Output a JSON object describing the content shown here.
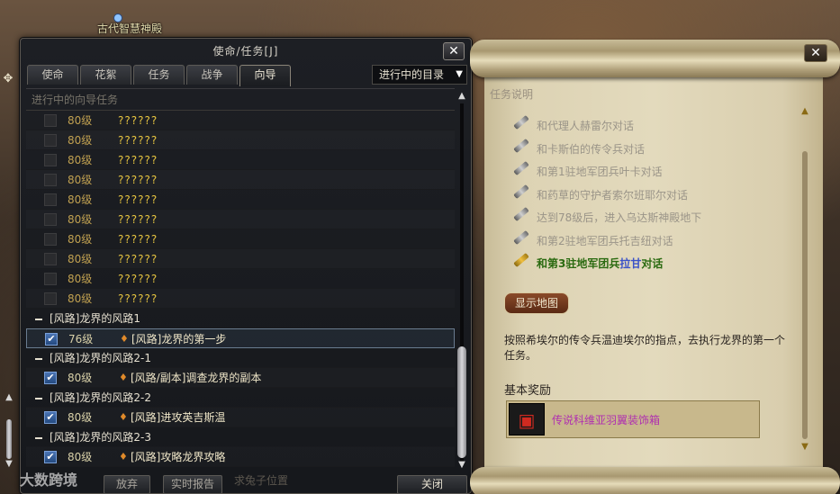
{
  "world": {
    "location_name": "古代智慧神殿",
    "watermark": "大数跨境",
    "chat_snippet": "求兔子位置"
  },
  "quest_window": {
    "title": "使命/任务[J]",
    "close_label": "✕",
    "tabs": [
      {
        "label": "使命",
        "active": false
      },
      {
        "label": "花絮",
        "active": false
      },
      {
        "label": "任务",
        "active": false
      },
      {
        "label": "战争",
        "active": false
      },
      {
        "label": "向导",
        "active": true
      }
    ],
    "filter": {
      "value": "进行中的目录"
    },
    "section_header": "进行中的向导任务",
    "locked_rows": [
      {
        "level": "80级",
        "name": "??????"
      },
      {
        "level": "80级",
        "name": "??????"
      },
      {
        "level": "80级",
        "name": "??????"
      },
      {
        "level": "80级",
        "name": "??????"
      },
      {
        "level": "80级",
        "name": "??????"
      },
      {
        "level": "80级",
        "name": "??????"
      },
      {
        "level": "80级",
        "name": "??????"
      },
      {
        "level": "80级",
        "name": "??????"
      },
      {
        "level": "80级",
        "name": "??????"
      },
      {
        "level": "80级",
        "name": "??????"
      }
    ],
    "groups": [
      {
        "title": "[风路]龙界的风路1",
        "quest": {
          "level": "76级",
          "name": "[风路]龙界的第一步",
          "selected": true
        }
      },
      {
        "title": "[风路]龙界的风路2-1",
        "quest": {
          "level": "80级",
          "name": "[风路/副本]调查龙界的副本",
          "selected": false
        }
      },
      {
        "title": "[风路]龙界的风路2-2",
        "quest": {
          "level": "80级",
          "name": "[风路]进攻英吉斯温",
          "selected": false
        }
      },
      {
        "title": "[风路]龙界的风路2-3",
        "quest": {
          "level": "80级",
          "name": "[风路]攻略龙界攻略",
          "selected": false
        }
      }
    ],
    "footer": {
      "abandon_label": "放弃",
      "report_label": "实时报告",
      "close_label": "关闭"
    }
  },
  "detail_panel": {
    "close_label": "✕",
    "section_label": "任务说明",
    "steps": [
      {
        "text": "和代理人赫雷尔对话",
        "current": false
      },
      {
        "text": "和卡斯伯的传令兵对话",
        "current": false
      },
      {
        "text": "和第1驻地军团兵叶卡对话",
        "current": false
      },
      {
        "text": "和药草的守护者索尔班耶尔对话",
        "current": false
      },
      {
        "text": "达到78级后，进入乌达斯神殿地下",
        "current": false
      },
      {
        "text": "和第2驻地军团兵托吉纽对话",
        "current": false
      }
    ],
    "current_step": {
      "prefix": "和第3驻地军团兵",
      "npc": "拉甘",
      "suffix": "对话"
    },
    "show_map_label": "显示地图",
    "description": "按照希埃尔的传令兵温迪埃尔的指点，去执行龙界的第一个任务。",
    "reward_label": "基本奖励",
    "reward_item": {
      "name": "传说科维亚羽翼装饰箱",
      "icon": "treasure-chest-icon"
    }
  }
}
